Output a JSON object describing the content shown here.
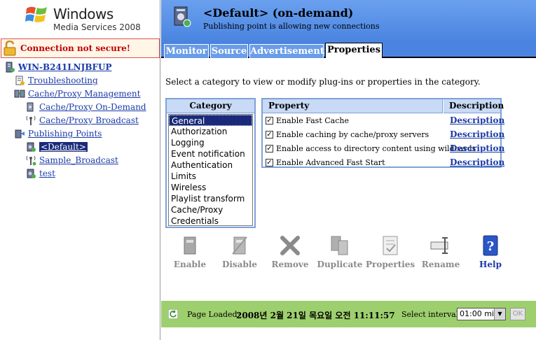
{
  "logo": {
    "line1": "Windows",
    "line2": "Media Services 2008"
  },
  "security_warning": "Connection not secure!",
  "tree": [
    {
      "label": "WIN-B241LNJBFUP"
    },
    {
      "label": "Troubleshooting"
    },
    {
      "label": "Cache/Proxy Management"
    },
    {
      "label": "Cache/Proxy On-Demand"
    },
    {
      "label": "Cache/Proxy Broadcast"
    },
    {
      "label": "Publishing Points"
    },
    {
      "label": "<Default>"
    },
    {
      "label": "Sample_Broadcast"
    },
    {
      "label": "test"
    }
  ],
  "header": {
    "title": "<Default>  (on-demand)",
    "subtitle": "Publishing point is allowing new connections"
  },
  "tabs": [
    "Monitor",
    "Source",
    "Advertisement",
    "Properties"
  ],
  "instruction": "Select a category to view or modify plug-ins or properties in the category.",
  "category": {
    "header": "Category",
    "items": [
      "General",
      "Authorization",
      "Logging",
      "Event notification",
      "Authentication",
      "Limits",
      "Wireless",
      "Playlist transform",
      "Cache/Proxy",
      "Credentials"
    ]
  },
  "properties": {
    "col_property": "Property",
    "col_description": "Description",
    "rows": [
      {
        "label": "Enable Fast Cache",
        "desc": "Description",
        "checked": true
      },
      {
        "label": "Enable caching by cache/proxy servers",
        "desc": "Description",
        "checked": true
      },
      {
        "label": "Enable access to directory content using wildcards",
        "desc": "Description",
        "checked": true
      },
      {
        "label": "Enable Advanced Fast Start",
        "desc": "Description",
        "checked": true
      }
    ]
  },
  "actions": [
    "Enable",
    "Disable",
    "Remove",
    "Duplicate",
    "Properties",
    "Rename",
    "Help"
  ],
  "footer": {
    "page_loaded_label": "Page Loaded:",
    "page_loaded_value": "2008년 2월 21일 목요일 오전 11:11:57",
    "interval_label": "Select interval:",
    "interval_value": "01:00 min",
    "ok_label": "OK"
  },
  "colors": {
    "banner": "#4a84e0",
    "footer": "#9ecf6e",
    "link": "#1a3aa8",
    "warning": "#c00000"
  }
}
